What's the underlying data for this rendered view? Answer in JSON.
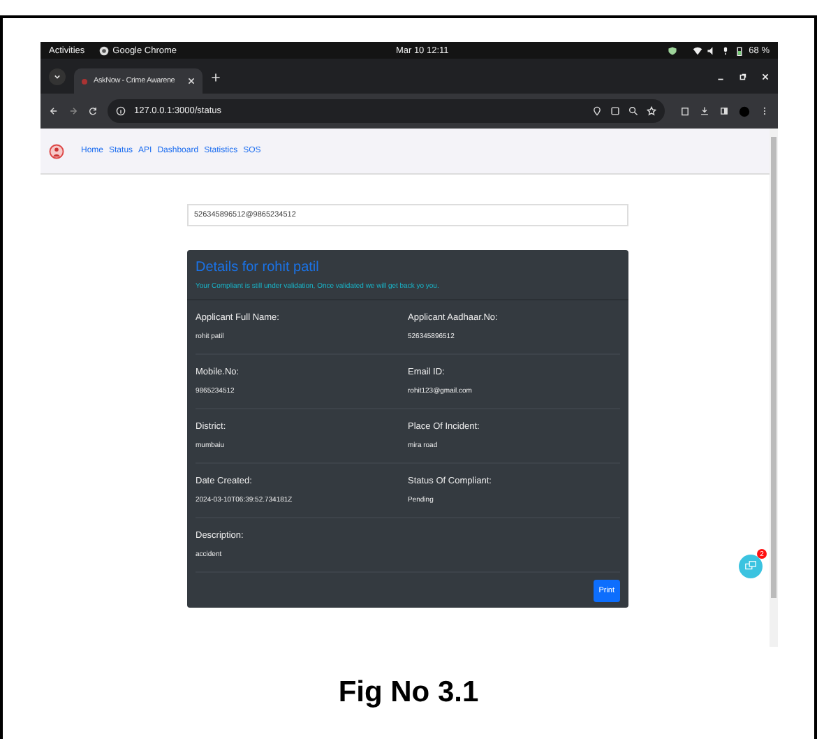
{
  "system_bar": {
    "activities": "Activities",
    "app_name": "Google Chrome",
    "clock": "Mar 10  12:11",
    "battery": "68 %"
  },
  "browser": {
    "tab_title": "AskNow - Crime Awarene",
    "url": "127.0.0.1:3000/status"
  },
  "nav": {
    "links": [
      {
        "label": "Home"
      },
      {
        "label": "Status"
      },
      {
        "label": "API"
      },
      {
        "label": "Dashboard"
      },
      {
        "label": "Statistics"
      },
      {
        "label": "SOS"
      }
    ]
  },
  "search": {
    "value": "526345896512@9865234512"
  },
  "details": {
    "title": "Details for rohit patil",
    "notice": "Your Compliant is still under validation, Once validated we will get back yo you.",
    "fields": [
      {
        "label": "Applicant Full Name:",
        "value": "rohit patil"
      },
      {
        "label": "Applicant Aadhaar.No:",
        "value": "526345896512"
      },
      {
        "label": "Mobile.No:",
        "value": "9865234512"
      },
      {
        "label": "Email ID:",
        "value": "rohit123@gmail.com"
      },
      {
        "label": "District:",
        "value": "mumbaiu"
      },
      {
        "label": "Place Of Incident:",
        "value": "mira road"
      },
      {
        "label": "Date Created:",
        "value": "2024-03-10T06:39:52.734181Z"
      },
      {
        "label": "Status Of Compliant:",
        "value": "Pending"
      },
      {
        "label": "Description:",
        "value": "accident"
      }
    ],
    "print_button": "Print"
  },
  "chat": {
    "badge": "2"
  },
  "caption": "Fig No 3.1"
}
